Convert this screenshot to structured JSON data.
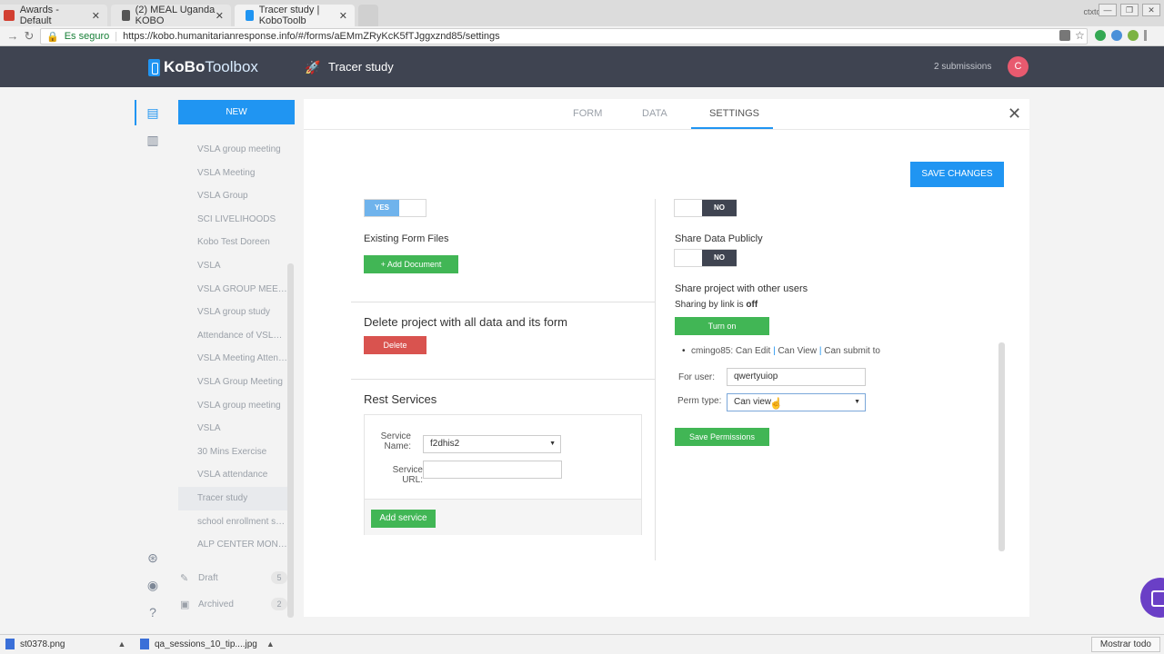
{
  "browser": {
    "tabs": [
      {
        "label": "Awards - Default",
        "close": "✕",
        "icon_color": "#d23f31",
        "active": false
      },
      {
        "label": "(2) MEAL Uganda KOBO",
        "close": "✕",
        "icon_color": "#555555",
        "active": false
      },
      {
        "label": "Tracer study | KoboToolb",
        "close": "✕",
        "icon_color": "#2095f2",
        "active": true
      }
    ],
    "context_label": "ctxtotal",
    "window_controls": [
      "—",
      "❐",
      "✕"
    ],
    "secure_label": "Es seguro",
    "url": "https://kobo.humanitarianresponse.info/#/forms/aEMmZRyKcK5fTJggxznd85/settings"
  },
  "header": {
    "logo_part1": "KoBo",
    "logo_part2": "Toolbox",
    "project_title": "Tracer study",
    "submissions": "2 submissions",
    "avatar_initial": "C"
  },
  "sidebar": {
    "new_label": "NEW",
    "items": [
      "VSLA group meeting",
      "VSLA Meeting",
      "VSLA Group",
      "SCI LIVELIHOODS",
      "Kobo Test Doreen",
      "VSLA",
      "VSLA GROUP MEETI...",
      "VSLA group study",
      "Attendance of VSLA ...",
      "VSLA Meeting Attend...",
      "VSLA Group Meeting",
      "VSLA group meeting",
      "VSLA",
      "30 Mins Exercise",
      "VSLA attendance",
      "Tracer study",
      "school enrollment su...",
      "ALP CENTER MONIT..."
    ],
    "active_item": "Tracer study",
    "draft_label": "Draft",
    "draft_count": "5",
    "archived_label": "Archived",
    "archived_count": "2"
  },
  "tabs": {
    "form": "FORM",
    "data": "DATA",
    "settings": "SETTINGS"
  },
  "settings": {
    "save_changes": "SAVE CHANGES",
    "yes_toggle": "YES",
    "no_toggle_top": "NO",
    "existing_files_label": "Existing Form Files",
    "add_document": "+ Add Document",
    "share_data_label": "Share Data Publicly",
    "share_data_toggle": "NO",
    "delete_title": "Delete project with all data and its form",
    "delete_button": "Delete",
    "rest_title": "Rest Services",
    "service_name_label_1": "Service",
    "service_name_label_2": "Name:",
    "service_name_value": "f2dhis2",
    "service_url_label": "Service URL:",
    "add_service": "Add service",
    "share_users_label": "Share project with other users",
    "sharing_by_link_prefix": "Sharing by link is",
    "sharing_by_link_state": "off",
    "turn_on": "Turn on",
    "permission_user": "cmingo85:",
    "permission_1": "Can Edit",
    "permission_2": "Can View",
    "permission_3": "Can submit to",
    "permission_sep": "|",
    "for_user_label": "For user:",
    "for_user_value": "qwertyuiop",
    "perm_type_label": "Perm type:",
    "perm_type_value": "Can view",
    "save_permissions": "Save Permissions"
  },
  "downloads": {
    "items": [
      "st0378.png",
      "qa_sessions_10_tip....jpg"
    ],
    "show_all": "Mostrar todo"
  },
  "colors": {
    "accent": "#2095f2",
    "header_bg": "#3f4451",
    "green": "#41b655",
    "danger": "#d9534f",
    "toggle_dark": "#3f4451",
    "toggle_light": "#6fb3ec"
  }
}
